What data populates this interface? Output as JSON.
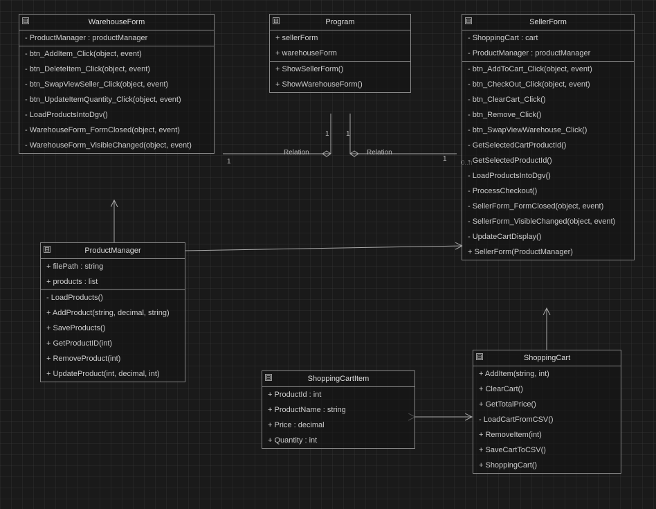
{
  "classes": {
    "warehouseForm": {
      "name": "WarehouseForm",
      "attributes": [
        "- ProductManager : productManager"
      ],
      "methods": [
        "- btn_AddItem_Click(object, event)",
        "- btn_DeleteItem_Click(object, event)",
        "- btn_SwapViewSeller_Click(object, event)",
        "- btn_UpdateItemQuantity_Click(object, event)",
        "- LoadProductsIntoDgv()",
        "- WarehouseForm_FormClosed(object, event)",
        "- WarehouseForm_VisibleChanged(object, event)"
      ]
    },
    "program": {
      "name": "Program",
      "attributes": [
        "+ sellerForm",
        "+ warehouseForm"
      ],
      "methods": [
        "+ ShowSellerForm()",
        "+ ShowWarehouseForm()"
      ]
    },
    "sellerForm": {
      "name": "SellerForm",
      "attributes": [
        "- ShoppingCart : cart",
        "- ProductManager : productManager"
      ],
      "methods": [
        "- btn_AddToCart_Click(object, event)",
        "- btn_CheckOut_Click(object, event)",
        "- btn_ClearCart_Click()",
        "- btn_Remove_Click()",
        "- btn_SwapViewWarehouse_Click()",
        "- GetSelectedCartProductId()",
        "- GetSelectedProductId()",
        "- LoadProductsIntoDgv()",
        "- ProcessCheckout()",
        "- SellerForm_FormClosed(object, event)",
        "- SellerForm_VisibleChanged(object, event)",
        "- UpdateCartDisplay()",
        "+ SellerForm(ProductManager)"
      ]
    },
    "productManager": {
      "name": "ProductManager",
      "attributes": [
        "+ filePath : string",
        "+ products : list"
      ],
      "methods": [
        "- LoadProducts()",
        "+ AddProduct(string, decimal, string)",
        "+ SaveProducts()",
        "+ GetProductID(int)",
        "+ RemoveProduct(int)",
        "+ UpdateProduct(int, decimal, int)"
      ]
    },
    "shoppingCartItem": {
      "name": "ShoppingCartItem",
      "attributes": [
        "+ ProductId : int",
        "+ ProductName : string",
        "+ Price : decimal",
        "+ Quantity : int"
      ],
      "methods": []
    },
    "shoppingCart": {
      "name": "ShoppingCart",
      "attributes": [],
      "methods": [
        "+ AddItem(string, int)",
        "+ ClearCart()",
        "+ GetTotalPrice()",
        "- LoadCartFromCSV()",
        "+ RemoveItem(int)",
        "+ SaveCartToCSV()",
        "+ ShoppingCart()"
      ]
    }
  },
  "relations": {
    "program_warehouse": {
      "label": "Relation",
      "mult_program": "1",
      "mult_warehouse": "1"
    },
    "program_seller": {
      "label": "Relation",
      "mult_program": "1",
      "mult_seller": "1",
      "mult_seller_extra": "0..n"
    }
  },
  "collapse_glyph": "⊟"
}
